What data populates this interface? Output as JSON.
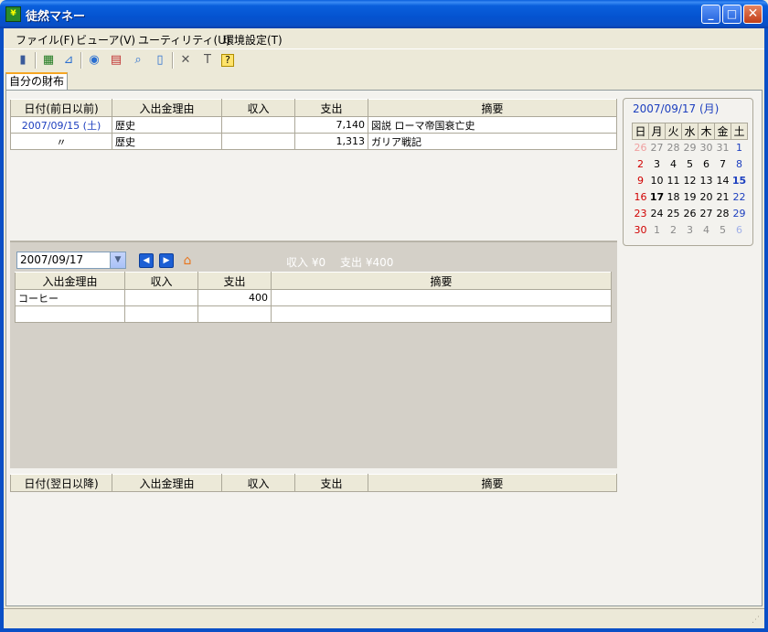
{
  "window": {
    "title": "徒然マネー",
    "icon_label": "¥"
  },
  "menu": [
    "ファイル(F)",
    "ビューア(V)",
    "ユーティリティ(U)",
    "環境設定(T)"
  ],
  "toolbar_icons": [
    "exit-icon",
    "sheet-icon",
    "chart-icon",
    "globe-icon",
    "data-icon",
    "search-icon",
    "page-icon",
    "tools-icon",
    "hammer-icon",
    "help-icon"
  ],
  "tab": {
    "label": "自分の財布"
  },
  "past_table": {
    "headers": [
      "日付(前日以前)",
      "入出金理由",
      "収入",
      "支出",
      "摘要"
    ],
    "rows": [
      {
        "date": "2007/09/15 (土)",
        "reason": "歴史",
        "income": "",
        "expense": "7,140",
        "memo": "図説 ローマ帝国衰亡史"
      },
      {
        "date": "〃",
        "reason": "歴史",
        "income": "",
        "expense": "1,313",
        "memo": "ガリア戦記"
      }
    ]
  },
  "today_panel": {
    "date": "2007/09/17",
    "summary": {
      "income": "収入 ¥0",
      "expense": "支出 ¥400"
    },
    "headers": [
      "入出金理由",
      "収入",
      "支出",
      "摘要"
    ],
    "rows": [
      {
        "reason": "コーヒー",
        "income": "",
        "expense": "400",
        "memo": ""
      },
      {
        "reason": "",
        "income": "",
        "expense": "",
        "memo": ""
      }
    ]
  },
  "future_table": {
    "headers": [
      "日付(翌日以降)",
      "入出金理由",
      "収入",
      "支出",
      "摘要"
    ]
  },
  "calendar": {
    "title": "2007/09/17 (月)",
    "weekdays": [
      "日",
      "月",
      "火",
      "水",
      "木",
      "金",
      "土"
    ],
    "weeks": [
      [
        "26",
        "27",
        "28",
        "29",
        "30",
        "31",
        "1"
      ],
      [
        "2",
        "3",
        "4",
        "5",
        "6",
        "7",
        "8"
      ],
      [
        "9",
        "10",
        "11",
        "12",
        "13",
        "14",
        "15"
      ],
      [
        "16",
        "17",
        "18",
        "19",
        "20",
        "21",
        "22"
      ],
      [
        "23",
        "24",
        "25",
        "26",
        "27",
        "28",
        "29"
      ],
      [
        "30",
        "1",
        "2",
        "3",
        "4",
        "5",
        "6"
      ]
    ]
  }
}
